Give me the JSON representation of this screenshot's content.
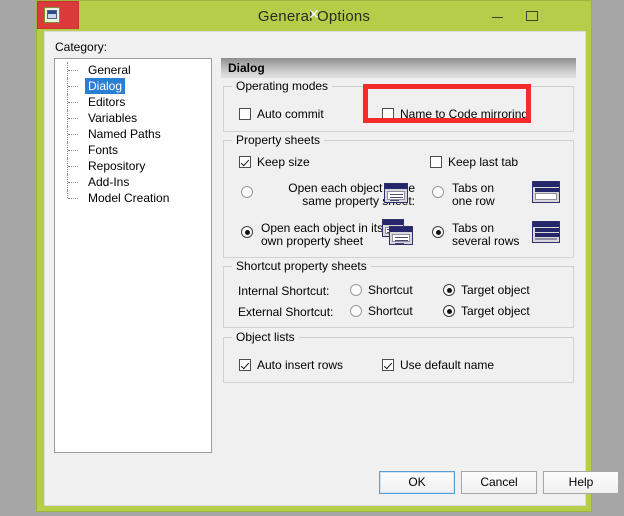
{
  "window": {
    "title": "General Options",
    "app_icon": "window-icon",
    "controls": {
      "minimize": "—",
      "maximize": "□",
      "close": "✕"
    }
  },
  "category": {
    "label": "Category:",
    "items": [
      {
        "label": "General",
        "selected": false
      },
      {
        "label": "Dialog",
        "selected": true
      },
      {
        "label": "Editors",
        "selected": false
      },
      {
        "label": "Variables",
        "selected": false
      },
      {
        "label": "Named Paths",
        "selected": false
      },
      {
        "label": "Fonts",
        "selected": false
      },
      {
        "label": "Repository",
        "selected": false
      },
      {
        "label": "Add-Ins",
        "selected": false
      },
      {
        "label": "Model Creation",
        "selected": false
      }
    ]
  },
  "pane": {
    "header": "Dialog",
    "operating_modes": {
      "title": "Operating modes",
      "auto_commit": {
        "label": "Auto commit",
        "checked": false
      },
      "name_to_code_mirroring": {
        "label": "Name to Code mirroring",
        "checked": false
      }
    },
    "property_sheets": {
      "title": "Property sheets",
      "keep_size": {
        "label": "Keep size",
        "checked": true
      },
      "keep_last_tab": {
        "label": "Keep last tab",
        "checked": false
      },
      "open_same_line1": "Open each object in the",
      "open_same_line2": "same property sheet:",
      "open_same_selected": false,
      "open_own_line1": "Open each object in its",
      "open_own_line2": "own property sheet",
      "open_own_selected": true,
      "tabs_one_line1": "Tabs on",
      "tabs_one_line2": "one row",
      "tabs_one_selected": false,
      "tabs_several_line1": "Tabs on",
      "tabs_several_line2": "several rows",
      "tabs_several_selected": true
    },
    "shortcut_property_sheets": {
      "title": "Shortcut property sheets",
      "internal_label": "Internal Shortcut:",
      "external_label": "External Shortcut:",
      "shortcut_option": "Shortcut",
      "target_option": "Target object",
      "internal_shortcut_selected": false,
      "internal_target_selected": true,
      "external_shortcut_selected": false,
      "external_target_selected": true
    },
    "object_lists": {
      "title": "Object lists",
      "auto_insert_rows": {
        "label": "Auto insert rows",
        "checked": true
      },
      "use_default_name": {
        "label": "Use default name",
        "checked": true
      }
    }
  },
  "footer": {
    "ok": "OK",
    "cancel": "Cancel",
    "help": "Help"
  },
  "annotation": {
    "color": "#f42b2b",
    "target": "Name to Code mirroring"
  },
  "colors": {
    "titlebar": "#b5ce4a",
    "close_button": "#dc3a3a",
    "selection": "#2a7fd4",
    "annotation": "#f42b2b"
  }
}
